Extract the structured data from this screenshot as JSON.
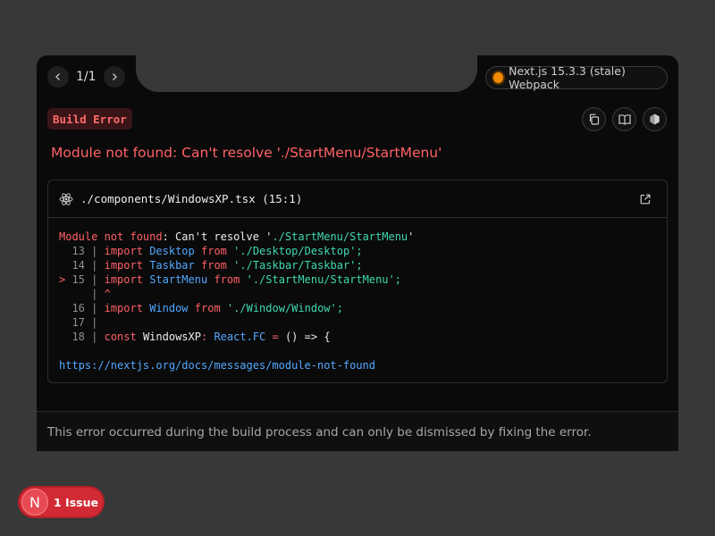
{
  "pager": {
    "text": "1/1"
  },
  "version": {
    "label": "Next.js 15.3.3 (stale) Webpack",
    "dot_color": "#f28b00"
  },
  "badge": {
    "label": "Build Error"
  },
  "toolbar": {
    "icons": [
      "copy-icon",
      "docs-book-icon",
      "nextjs-logo-icon"
    ]
  },
  "error": {
    "title": "Module not found: Can't resolve './StartMenu/StartMenu'"
  },
  "code": {
    "file": "./components/WindowsXP.tsx (15:1)",
    "message": {
      "prefix": "Module not found",
      "mid": ": Can't resolve '",
      "path": "./StartMenu/StartMenu",
      "end": "'"
    },
    "lines": [
      {
        "marker": "  ",
        "num": "13",
        "kw": "import",
        "name": "Desktop",
        "from": "from",
        "path": "'./Desktop/Desktop';"
      },
      {
        "marker": "  ",
        "num": "14",
        "kw": "import",
        "name": "Taskbar",
        "from": "from",
        "path": "'./Taskbar/Taskbar';"
      },
      {
        "marker": "> ",
        "num": "15",
        "kw": "import",
        "name": "StartMenu",
        "from": "from",
        "path": "'./StartMenu/StartMenu';"
      },
      {
        "caret": "^"
      },
      {
        "marker": "  ",
        "num": "16",
        "kw": "import",
        "name": "Window",
        "from": "from",
        "path": "'./Window/Window';"
      },
      {
        "marker": "  ",
        "num": "17"
      },
      {
        "marker": "  ",
        "num": "18",
        "kw": "const",
        "name": "WindowsXP",
        "sep": ":",
        "type": "React.FC",
        "eq": "=",
        "fn": "() =>",
        "brace": "{"
      }
    ],
    "link": "https://nextjs.org/docs/messages/module-not-found"
  },
  "footer": {
    "text": "This error occurred during the build process and can only be dismissed by fixing the error."
  },
  "issues": {
    "logo": "N",
    "label": "1 Issue"
  }
}
